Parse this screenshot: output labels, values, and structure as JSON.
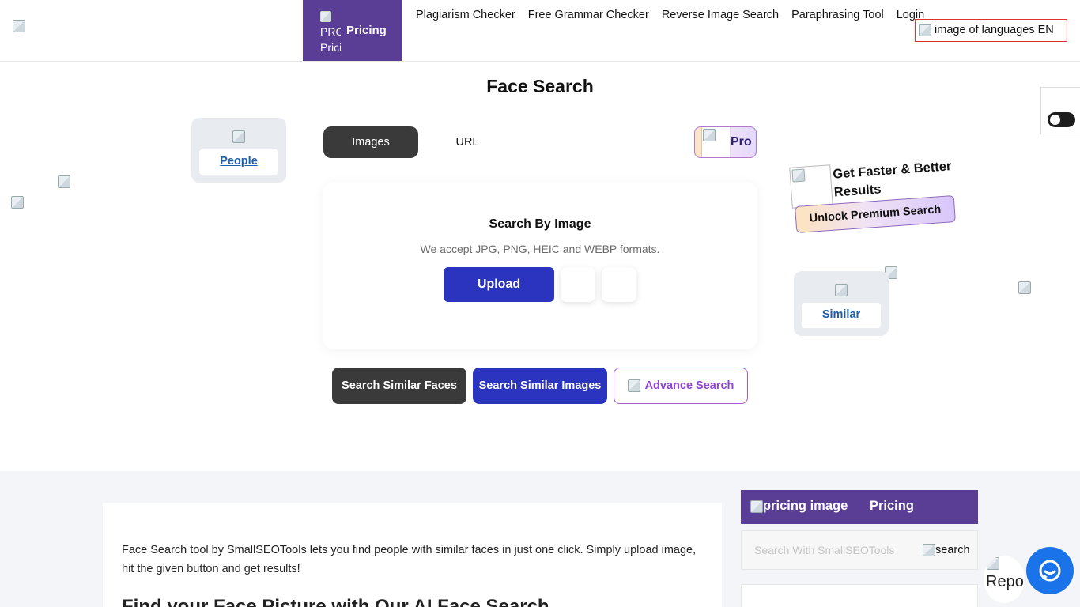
{
  "header": {
    "pricing_tab_img_alt": "PRO Pricing",
    "pricing_tab_label": "Pricing",
    "nav": [
      "Plagiarism Checker",
      "Free Grammar Checker",
      "Reverse Image Search",
      "Paraphrasing Tool",
      "Login"
    ],
    "language_alt": "image of languages EN"
  },
  "page_title": "Face Search",
  "side_cards": {
    "left_label": "People",
    "right_label": "Similar"
  },
  "tabs": {
    "images": "Images",
    "url": "URL",
    "pro": "Pro"
  },
  "upload": {
    "title": "Search By Image",
    "subtitle": "We accept JPG, PNG, HEIC and WEBP formats.",
    "button": "Upload"
  },
  "actions": {
    "faces": "Search Similar Faces",
    "images": "Search Similar Images",
    "advance": "Advance Search"
  },
  "promo": {
    "text": "Get Faster & Better Results",
    "button": "Unlock Premium Search"
  },
  "content": {
    "intro": "Face Search tool by SmallSEOTools lets you find people with similar faces in just one click. Simply upload image, hit the given button and get results!",
    "heading": "Find your Face Picture with Our AI Face Search"
  },
  "sidebar": {
    "pricing_img_alt": "pricing image",
    "pricing_label": "Pricing",
    "search_placeholder": "Search With SmallSEOTools",
    "search_icon_alt": "search"
  },
  "widgets": {
    "report_label": "Report"
  },
  "colors": {
    "brand_purple": "#5a3e96",
    "primary_blue": "#2a34bf",
    "dark": "#3a3a3a",
    "chat_blue": "#1a73e8"
  }
}
